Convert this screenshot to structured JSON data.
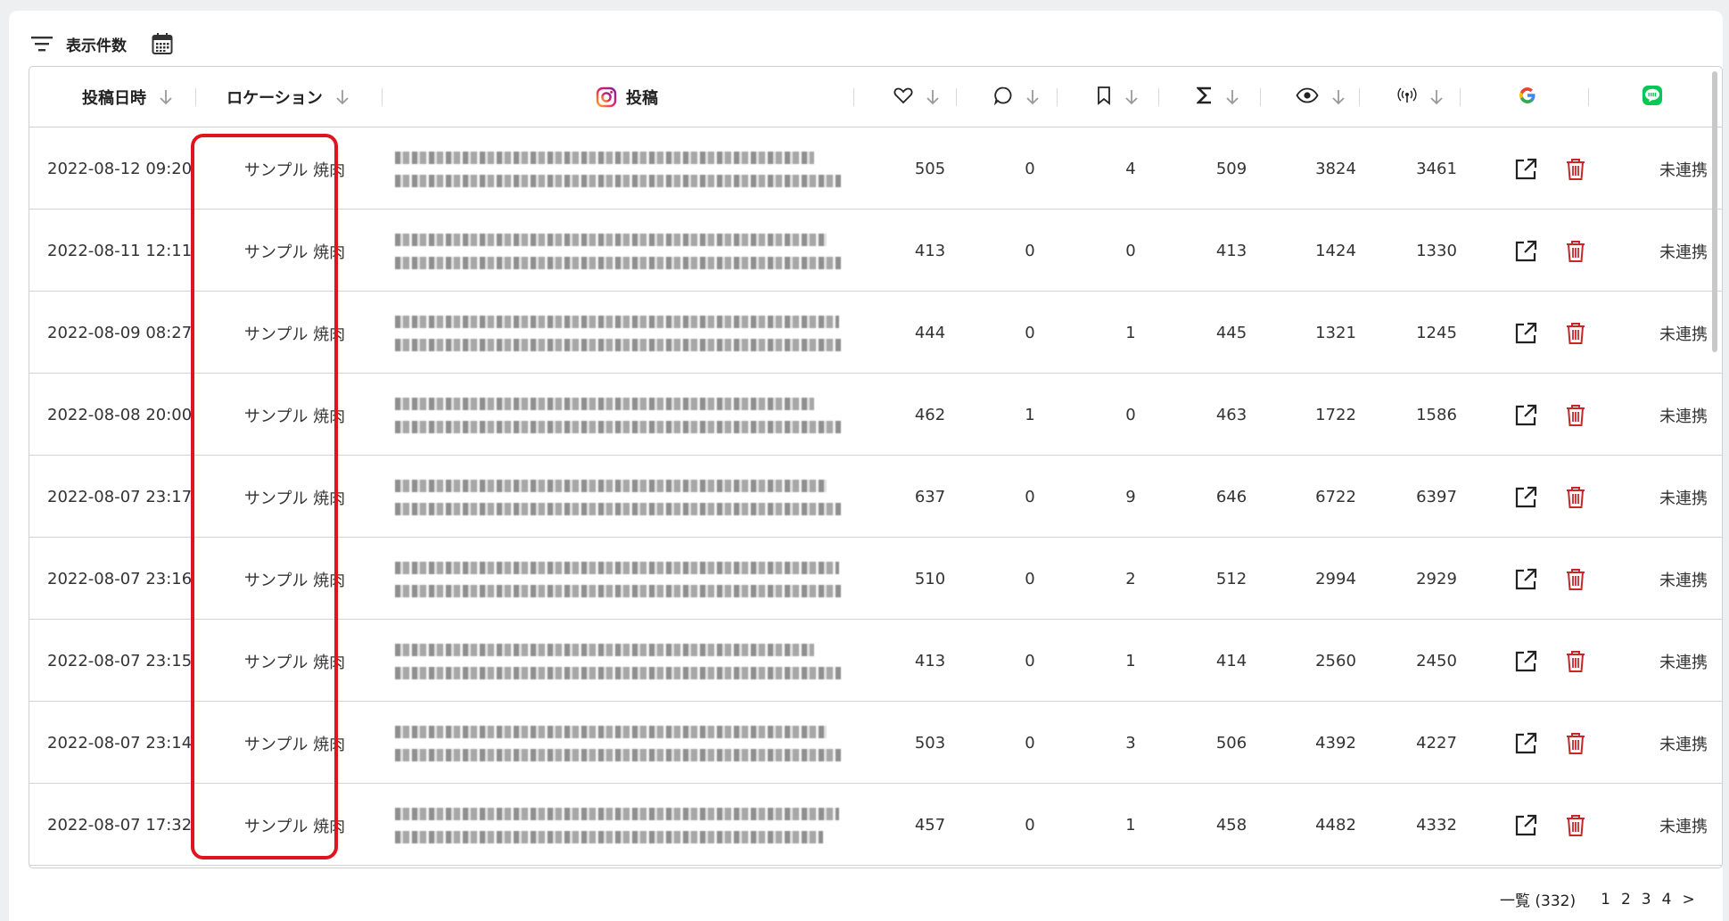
{
  "toolbar": {
    "display_count_label": "表示件数"
  },
  "table": {
    "headers": {
      "date": "投稿日時",
      "location": "ロケーション",
      "post": "投稿"
    },
    "rows": [
      {
        "date": "2022-08-12 09:20",
        "location": "サンプル 焼肉",
        "likes": "505",
        "comments": "0",
        "saves": "4",
        "total": "509",
        "impressions": "3824",
        "reach": "3461",
        "line_status": "未連携"
      },
      {
        "date": "2022-08-11 12:11",
        "location": "サンプル 焼肉",
        "likes": "413",
        "comments": "0",
        "saves": "0",
        "total": "413",
        "impressions": "1424",
        "reach": "1330",
        "line_status": "未連携"
      },
      {
        "date": "2022-08-09 08:27",
        "location": "サンプル 焼肉",
        "likes": "444",
        "comments": "0",
        "saves": "1",
        "total": "445",
        "impressions": "1321",
        "reach": "1245",
        "line_status": "未連携"
      },
      {
        "date": "2022-08-08 20:00",
        "location": "サンプル 焼肉",
        "likes": "462",
        "comments": "1",
        "saves": "0",
        "total": "463",
        "impressions": "1722",
        "reach": "1586",
        "line_status": "未連携"
      },
      {
        "date": "2022-08-07 23:17",
        "location": "サンプル 焼肉",
        "likes": "637",
        "comments": "0",
        "saves": "9",
        "total": "646",
        "impressions": "6722",
        "reach": "6397",
        "line_status": "未連携"
      },
      {
        "date": "2022-08-07 23:16",
        "location": "サンプル 焼肉",
        "likes": "510",
        "comments": "0",
        "saves": "2",
        "total": "512",
        "impressions": "2994",
        "reach": "2929",
        "line_status": "未連携"
      },
      {
        "date": "2022-08-07 23:15",
        "location": "サンプル 焼肉",
        "likes": "413",
        "comments": "0",
        "saves": "1",
        "total": "414",
        "impressions": "2560",
        "reach": "2450",
        "line_status": "未連携"
      },
      {
        "date": "2022-08-07 23:14",
        "location": "サンプル 焼肉",
        "likes": "503",
        "comments": "0",
        "saves": "3",
        "total": "506",
        "impressions": "4392",
        "reach": "4227",
        "line_status": "未連携"
      },
      {
        "date": "2022-08-07 17:32",
        "location": "サンプル 焼肉",
        "likes": "457",
        "comments": "0",
        "saves": "1",
        "total": "458",
        "impressions": "4482",
        "reach": "4332",
        "line_status": "未連携"
      }
    ]
  },
  "pagination": {
    "total_label": "一覧 (332)",
    "pages": [
      "1",
      "2",
      "3",
      "4"
    ],
    "next": ">"
  },
  "colors": {
    "highlight": "#e0141f",
    "delete_icon": "#c62828",
    "line_green": "#06c755"
  },
  "icons": [
    "filter-icon",
    "calendar-icon",
    "sort-down-arrow-icon",
    "instagram-icon",
    "heart-icon",
    "comment-icon",
    "bookmark-icon",
    "sigma-icon",
    "eye-icon",
    "reach-icon",
    "google-icon",
    "line-icon",
    "external-link-icon",
    "trash-icon"
  ]
}
